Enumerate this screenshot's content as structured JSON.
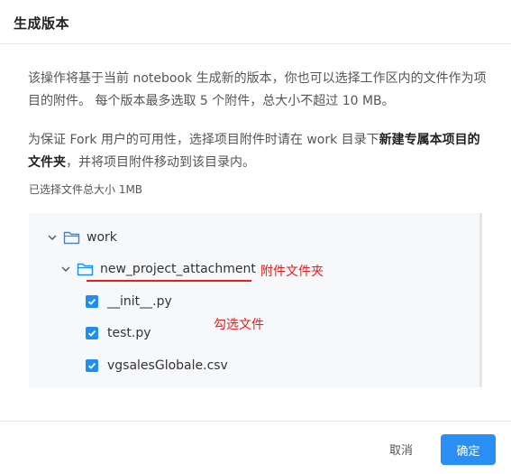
{
  "dialog": {
    "title": "生成版本",
    "paragraph1": "该操作将基于当前 notebook 生成新的版本，你也可以选择工作区内的文件作为项目的附件。 每个版本最多选取 5 个附件，总大小不超过 10 MB。",
    "paragraph2_prefix": "为保证 Fork 用户的可用性，选择项目附件时请在 work 目录下",
    "paragraph2_bold": "新建专属本项目的文件夹",
    "paragraph2_suffix": "，并将项目附件移动到该目录内。",
    "selected_size": "已选择文件总大小 1MB"
  },
  "tree": {
    "root": {
      "label": "work",
      "icon": "folder-icon",
      "expanded": true
    },
    "folder": {
      "label": "new_project_attachment",
      "icon": "folder-icon",
      "expanded": true
    },
    "files": [
      {
        "label": "__init__.py",
        "checked": true
      },
      {
        "label": "test.py",
        "checked": true
      },
      {
        "label": "vgsalesGlobale.csv",
        "checked": true
      }
    ]
  },
  "annotations": {
    "folder_note": "附件文件夹",
    "files_note": "勾选文件",
    "color": "#e61e1e"
  },
  "footer": {
    "cancel_label": "取消",
    "ok_label": "确定"
  },
  "colors": {
    "accent": "#2a8ff4",
    "checkbox": "#1e8ff0"
  }
}
